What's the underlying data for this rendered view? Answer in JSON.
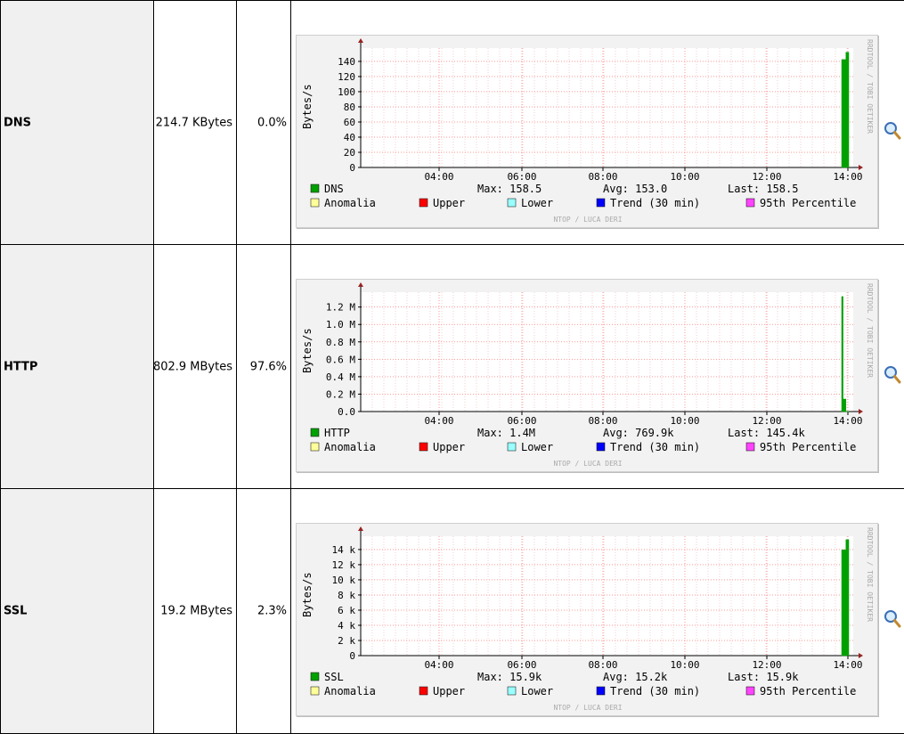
{
  "rows": [
    {
      "protocol": "DNS",
      "bytes": "214.7 KBytes",
      "percent": "0.0%",
      "chart": {
        "type": "area",
        "ylabel": "Bytes/s",
        "yticks": [
          "0",
          "20",
          "40",
          "60",
          "80",
          "100",
          "120",
          "140"
        ],
        "xticks": [
          "04:00",
          "06:00",
          "08:00",
          "10:00",
          "12:00",
          "14:00"
        ],
        "series_label": "DNS",
        "max": "Max: 158.5",
        "avg": "Avg: 153.0",
        "last": "Last: 158.5",
        "ylim": [
          0,
          160
        ],
        "points": [
          [
            0,
            148
          ],
          [
            1,
            148
          ],
          [
            2,
            148
          ],
          [
            3,
            158
          ],
          [
            4,
            158
          ]
        ],
        "legend2": [
          "Anomalia",
          "Upper",
          "Lower",
          "Trend (30 min)",
          "95th Percentile"
        ],
        "credit_right": "RRDTOOL / TOBI OETIKER",
        "credit_bottom": "NTOP / LUCA DERI"
      }
    },
    {
      "protocol": "HTTP",
      "bytes": "802.9 MBytes",
      "percent": "97.6%",
      "chart": {
        "type": "area",
        "ylabel": "Bytes/s",
        "yticks": [
          "0.0",
          "0.2 M",
          "0.4 M",
          "0.6 M",
          "0.8 M",
          "1.0 M",
          "1.2 M"
        ],
        "xticks": [
          "04:00",
          "06:00",
          "08:00",
          "10:00",
          "12:00",
          "14:00"
        ],
        "series_label": "HTTP",
        "max": "Max: 1.4M",
        "avg": "Avg: 769.9k",
        "last": "Last: 145.4k",
        "ylim": [
          0,
          1.4
        ],
        "points": [
          [
            0,
            1.38
          ],
          [
            1,
            0.15
          ],
          [
            2,
            0.15
          ],
          [
            3,
            0.0
          ],
          [
            4,
            0.0
          ]
        ],
        "legend2": [
          "Anomalia",
          "Upper",
          "Lower",
          "Trend (30 min)",
          "95th Percentile"
        ],
        "credit_right": "RRDTOOL / TOBI OETIKER",
        "credit_bottom": "NTOP / LUCA DERI"
      }
    },
    {
      "protocol": "SSL",
      "bytes": "19.2 MBytes",
      "percent": "2.3%",
      "chart": {
        "type": "area",
        "ylabel": "Bytes/s",
        "yticks": [
          "0",
          "2 k",
          "4 k",
          "6 k",
          "8 k",
          "10 k",
          "12 k",
          "14 k"
        ],
        "xticks": [
          "04:00",
          "06:00",
          "08:00",
          "10:00",
          "12:00",
          "14:00"
        ],
        "series_label": "SSL",
        "max": "Max: 15.9k",
        "avg": "Avg: 15.2k",
        "last": "Last: 15.9k",
        "ylim": [
          0,
          16
        ],
        "points": [
          [
            0,
            14.5
          ],
          [
            1,
            14.5
          ],
          [
            2,
            14.5
          ],
          [
            3,
            15.9
          ],
          [
            4,
            15.9
          ]
        ],
        "legend2": [
          "Anomalia",
          "Upper",
          "Lower",
          "Trend (30 min)",
          "95th Percentile"
        ],
        "credit_right": "RRDTOOL / TOBI OETIKER",
        "credit_bottom": "NTOP / LUCA DERI"
      }
    }
  ],
  "colors": {
    "series": "#00a000",
    "anomalia": "#ffff99",
    "upper": "#ff0000",
    "lower": "#99ffff",
    "trend": "#0000ff",
    "percentile": "#ff44ff",
    "grid": "#ff9999",
    "axis_arrow": "#992222"
  },
  "icons": {
    "zoom": "magnifier-icon"
  }
}
